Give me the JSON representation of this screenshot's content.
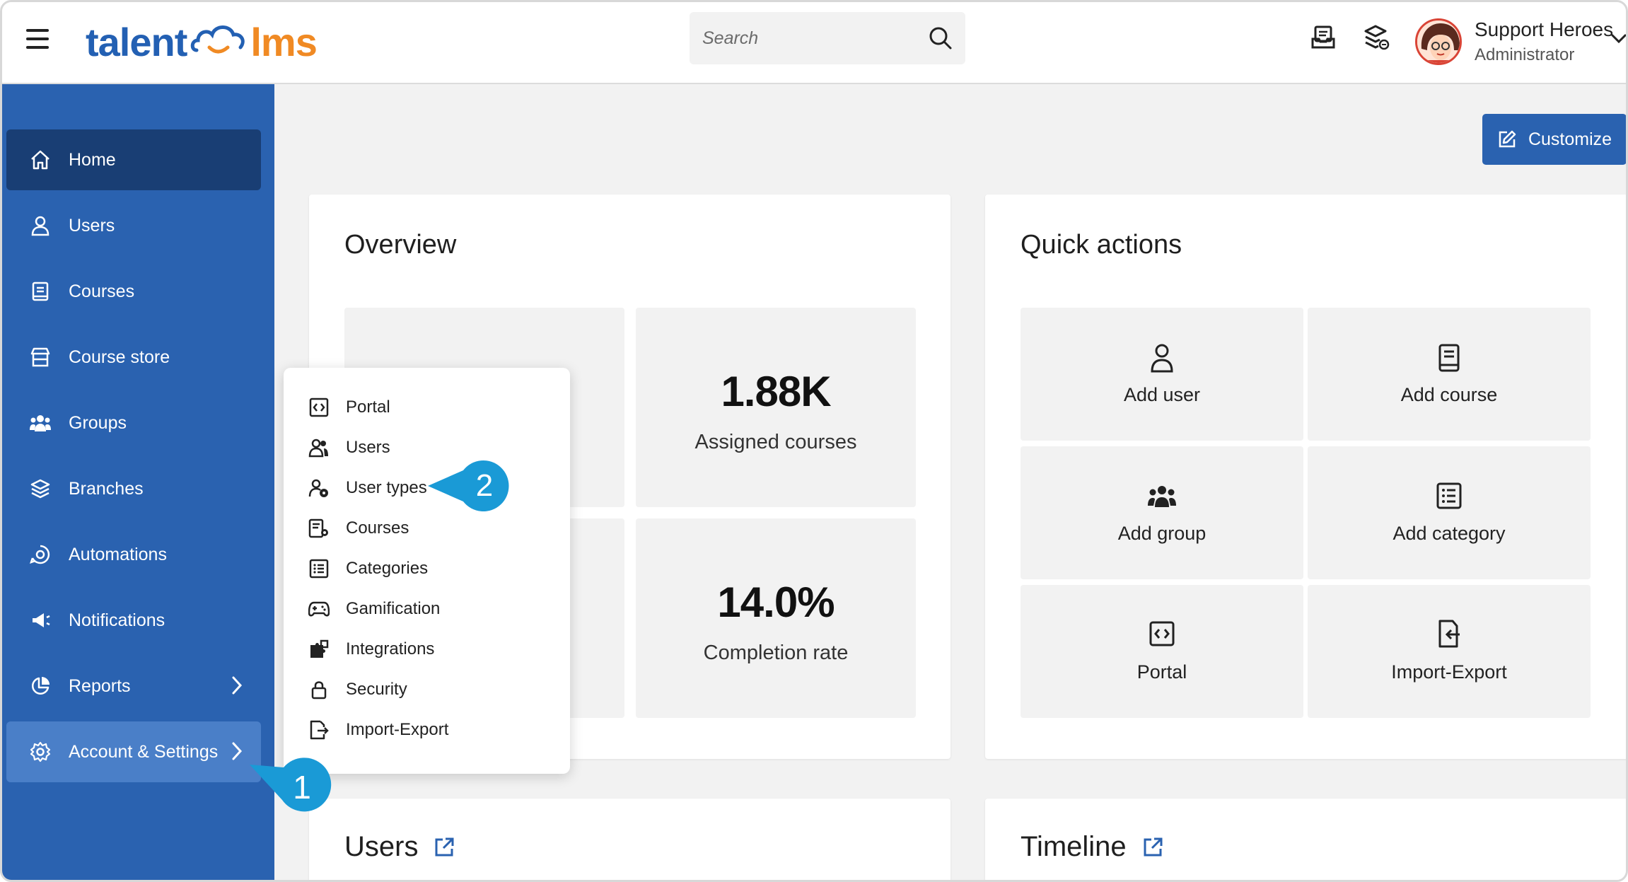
{
  "header": {
    "logo_left": "talent",
    "logo_right": "lms",
    "search_placeholder": "Search",
    "user_name": "Support Heroes",
    "user_role": "Administrator"
  },
  "sidebar": {
    "items": [
      {
        "label": "Home",
        "icon": "home-icon"
      },
      {
        "label": "Users",
        "icon": "user-icon"
      },
      {
        "label": "Courses",
        "icon": "book-icon"
      },
      {
        "label": "Course store",
        "icon": "store-icon"
      },
      {
        "label": "Groups",
        "icon": "group-icon"
      },
      {
        "label": "Branches",
        "icon": "layers-icon"
      },
      {
        "label": "Automations",
        "icon": "automation-icon"
      },
      {
        "label": "Notifications",
        "icon": "megaphone-icon"
      },
      {
        "label": "Reports",
        "icon": "pie-chart-icon"
      },
      {
        "label": "Account & Settings",
        "icon": "gear-icon"
      }
    ]
  },
  "main": {
    "customize_label": "Customize",
    "overview": {
      "title": "Overview",
      "stats": [
        {
          "value": "1.88K",
          "label": "Assigned courses"
        },
        {
          "value": "14.0%",
          "label": "Completion rate"
        }
      ]
    },
    "quick_actions": {
      "title": "Quick actions",
      "items": [
        {
          "label": "Add user",
          "icon": "add-user-icon"
        },
        {
          "label": "Add course",
          "icon": "book-icon"
        },
        {
          "label": "Add group",
          "icon": "group-icon"
        },
        {
          "label": "Add category",
          "icon": "list-icon"
        },
        {
          "label": "Portal",
          "icon": "portal-icon"
        },
        {
          "label": "Import-Export",
          "icon": "import-export-icon"
        }
      ]
    },
    "users_section_title": "Users",
    "timeline_section_title": "Timeline"
  },
  "settings_menu": {
    "items": [
      {
        "label": "Portal",
        "icon": "portal-icon"
      },
      {
        "label": "Users",
        "icon": "users-icon"
      },
      {
        "label": "User types",
        "icon": "user-type-icon"
      },
      {
        "label": "Courses",
        "icon": "course-settings-icon"
      },
      {
        "label": "Categories",
        "icon": "list-icon"
      },
      {
        "label": "Gamification",
        "icon": "gamepad-icon"
      },
      {
        "label": "Integrations",
        "icon": "puzzle-icon"
      },
      {
        "label": "Security",
        "icon": "lock-icon"
      },
      {
        "label": "Import-Export",
        "icon": "import-export-icon"
      }
    ]
  },
  "callouts": {
    "step1": "1",
    "step2": "2"
  },
  "colors": {
    "sidebar": "#2a62b0",
    "sidebar_active": "#193e74",
    "accent": "#2a62b0",
    "callout": "#1a9ad6",
    "logo_orange": "#f08a24"
  }
}
